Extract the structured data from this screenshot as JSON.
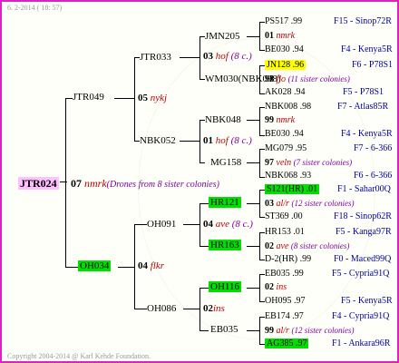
{
  "header": {
    "date": "6.  2-2014 ( 18: 57)"
  },
  "footer": {
    "copyright": "Copyright 2004-2014 @ Karl Kehde Foundation."
  },
  "root": {
    "id": "JTR024",
    "year": "07",
    "breeder": "nmrk",
    "note": "(Drones from 8 sister colonies)"
  },
  "sire": {
    "id": "JTR049",
    "children": [
      {
        "id": "JTR033",
        "year": "05",
        "breeder": "nykj",
        "children": [
          {
            "id": "JMN205",
            "year": "03",
            "breeder": "hof",
            "note": "(8 c.)",
            "children": [
              {
                "id": "PS517",
                "val": ".99",
                "origin": "F15 - Sinop72R"
              },
              {
                "id": "01",
                "breeder": "nmrk"
              },
              {
                "id": "BE030",
                "val": ".94",
                "origin": "F4 - Kenya5R"
              }
            ]
          },
          {
            "id": "WM030(NBK098)",
            "year": "",
            "breeder": "",
            "children": [
              {
                "id": "JN128",
                "val": ".96",
                "origin": "F6 - P78S1"
              },
              {
                "id": "98",
                "breeder": "flo",
                "note": "(11 sister colonies)"
              },
              {
                "id": "AK028",
                "val": ".94",
                "origin": "F5 - P78S1"
              }
            ]
          }
        ]
      },
      {
        "id": "NBK052",
        "year": "",
        "breeder": "",
        "children": [
          {
            "id": "NBK048",
            "year": "01",
            "breeder": "hof",
            "note": "(8 c.)",
            "children": [
              {
                "id": "NBK008",
                "val": ".98",
                "origin": "F7 - Atlas85R"
              },
              {
                "id": "99",
                "breeder": "nmrk"
              },
              {
                "id": "BE030",
                "val": ".94",
                "origin": "F4 - Kenya5R"
              }
            ]
          },
          {
            "id": "MG158",
            "year": "",
            "breeder": "",
            "children": [
              {
                "id": "MG079",
                "val": ".95",
                "origin": "F7 - 6-366"
              },
              {
                "id": "97",
                "breeder": "veln",
                "note": "(7 sister colonies)"
              },
              {
                "id": "NBK068",
                "val": ".93",
                "origin": "F6 - 6-366"
              }
            ]
          }
        ]
      }
    ]
  },
  "dam": {
    "id": "OH034",
    "year": "04",
    "breeder": "flkr",
    "children": [
      {
        "id": "OH091",
        "year": "04",
        "breeder": "ave",
        "note": "(8 c.)",
        "children": [
          {
            "id": "HR121",
            "children": [
              {
                "id": "S121(HR)",
                "val": ".01",
                "origin": "F1 - Sahar00Q"
              },
              {
                "id": "03",
                "breeder": "al/r",
                "note": "(12 sister colonies)"
              },
              {
                "id": "ST369",
                "val": ".00",
                "origin": "F18 - Sinop62R"
              }
            ]
          },
          {
            "id": "HR163",
            "children": [
              {
                "id": "HR153",
                "val": ".01",
                "origin": "F5 - Kanga97R"
              },
              {
                "id": "02",
                "breeder": "ave",
                "note": "(8 sister colonies)"
              },
              {
                "id": "D-2(HR)",
                "val": ".99",
                "origin": "F0 - Maced99Q"
              }
            ]
          }
        ]
      },
      {
        "id": "OH086",
        "year": "02",
        "breeder": "ins",
        "children": [
          {
            "id": "OH116",
            "children": [
              {
                "id": "EB035",
                "val": ".99",
                "origin": "F5 - Cypria91Q"
              },
              {
                "id": "02",
                "breeder": "ins"
              },
              {
                "id": "OH095",
                "val": ".97",
                "origin": "F5 - Kenya5R"
              }
            ]
          },
          {
            "id": "EB035",
            "children": [
              {
                "id": "EB174",
                "val": ".97",
                "origin": "F4 - Cypria91Q"
              },
              {
                "id": "99",
                "breeder": "al/r",
                "note": "(12 sister colonies)"
              },
              {
                "id": "AG385",
                "val": ".97",
                "origin": "F1 - Ankara96R"
              }
            ]
          }
        ]
      }
    ]
  }
}
